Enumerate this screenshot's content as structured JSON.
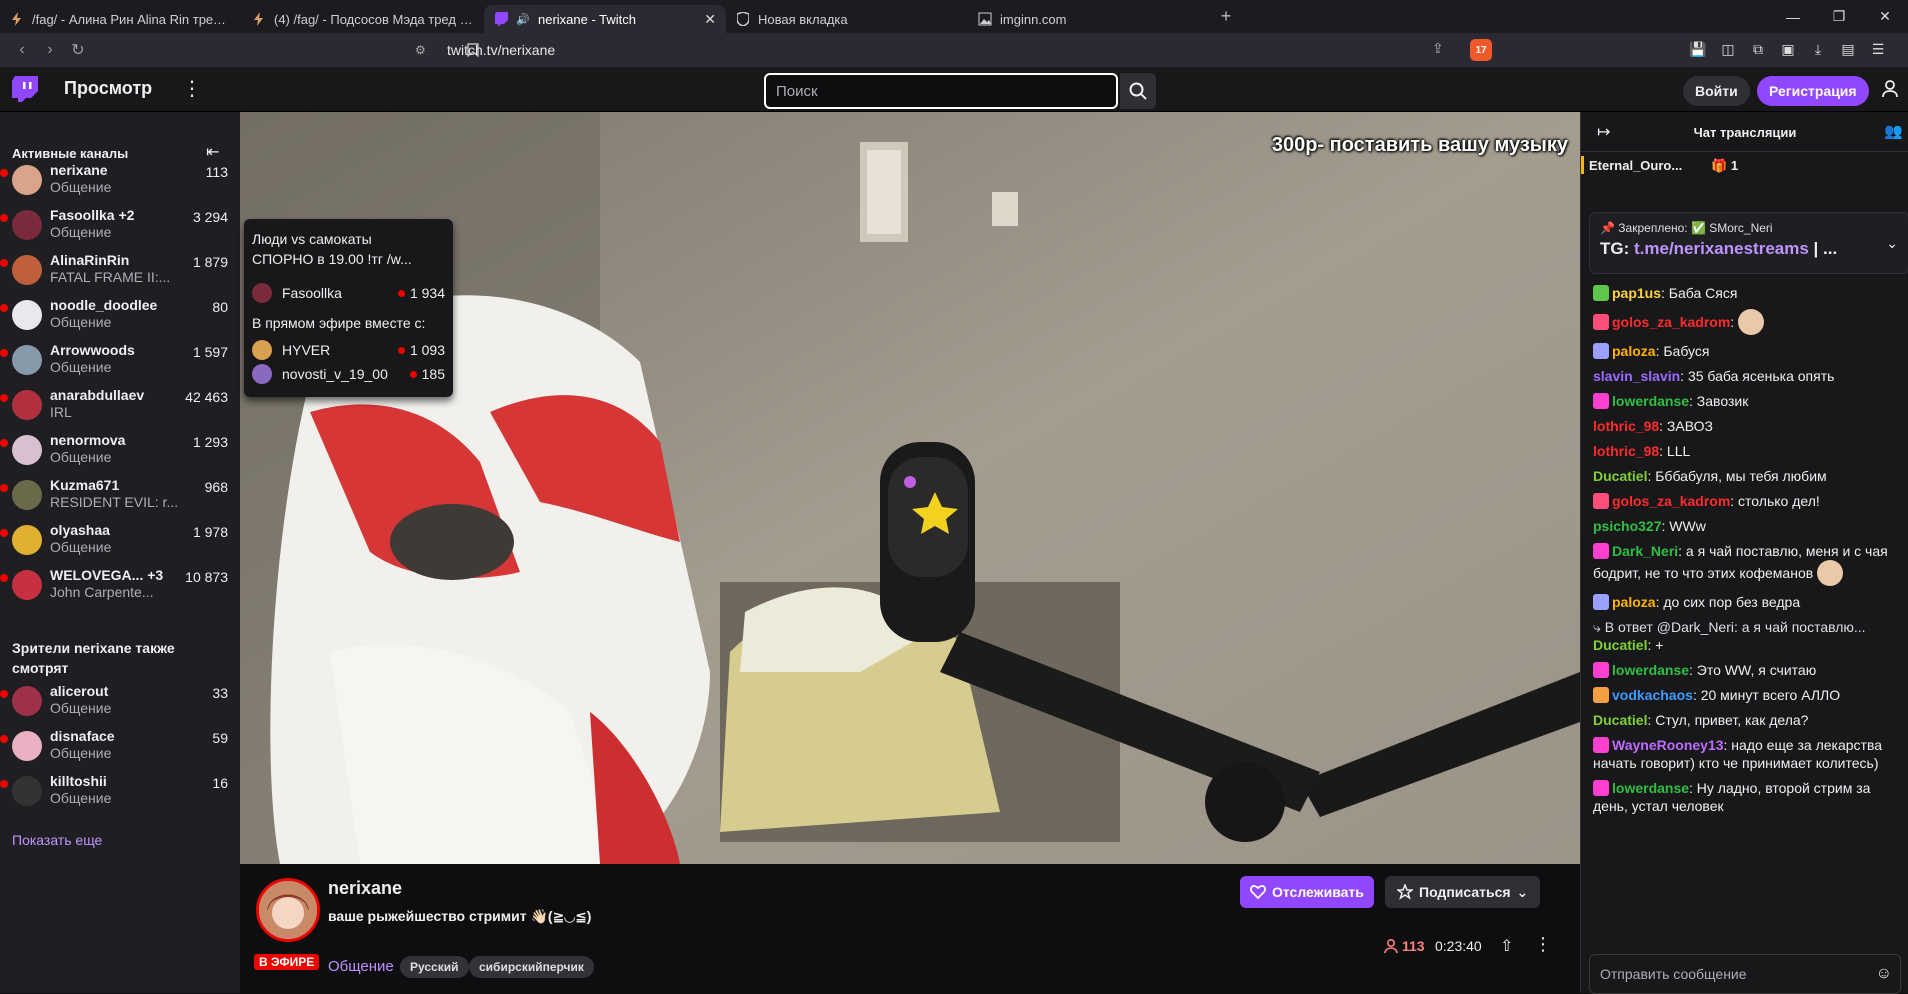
{
  "browser": {
    "tabs": [
      {
        "title": "/fag/ - Алина Рин Alina Rin тред #10",
        "active": false
      },
      {
        "title": "(4) /fag/ - Подсосов Мэда тред №12",
        "active": false
      },
      {
        "title": "nerixane - Twitch",
        "active": true
      },
      {
        "title": "Новая вкладка",
        "active": false
      },
      {
        "title": "imginn.com",
        "active": false
      }
    ],
    "new_tab": "+",
    "url": "twitch.tv/nerixane",
    "brave_badge": "17"
  },
  "twitch_nav": {
    "browse": "Просмотр",
    "search_placeholder": "Поиск",
    "login": "Войти",
    "signup": "Регистрация"
  },
  "sidebar": {
    "active_header": "Активные каналы",
    "channels": [
      {
        "name": "nerixane",
        "category": "Общение",
        "viewers": "113",
        "color": "#d9a58a"
      },
      {
        "name": "Fasoollka +2",
        "category": "Общение",
        "viewers": "3 294",
        "color": "#7a2a3a"
      },
      {
        "name": "AlinaRinRin",
        "category": "FATAL FRAME II:...",
        "viewers": "1 879",
        "color": "#c0603a"
      },
      {
        "name": "noodle_doodlee",
        "category": "Общение",
        "viewers": "80",
        "color": "#e8e8ee"
      },
      {
        "name": "Arrowwoods",
        "category": "Общение",
        "viewers": "1 597",
        "color": "#8899aa"
      },
      {
        "name": "anarabdullaev",
        "category": "IRL",
        "viewers": "42 463",
        "color": "#b03040"
      },
      {
        "name": "nenormova",
        "category": "Общение",
        "viewers": "1 293",
        "color": "#d8c0d0"
      },
      {
        "name": "Kuzma671",
        "category": "RESIDENT EVIL: r...",
        "viewers": "968",
        "color": "#6a6a4a"
      },
      {
        "name": "olyashaa",
        "category": "Общение",
        "viewers": "1 978",
        "color": "#e0b030"
      },
      {
        "name": "WELOVEGA...  +3",
        "category": "John Carpente...",
        "viewers": "10 873",
        "color": "#c83040"
      }
    ],
    "also_header": "Зрители nerixane также смотрят",
    "also": [
      {
        "name": "alicerout",
        "category": "Общение",
        "viewers": "33",
        "color": "#a0304a"
      },
      {
        "name": "disnaface",
        "category": "Общение",
        "viewers": "59",
        "color": "#e8b0c0"
      },
      {
        "name": "killtoshii",
        "category": "Общение",
        "viewers": "16",
        "color": "#333333"
      }
    ],
    "show_more": "Показать еще"
  },
  "video": {
    "overlay_text": "300р- поставить вашу музыку"
  },
  "tooltip": {
    "title_line1": "Люди vs самокаты",
    "title_line2": "СПОРНО в 19.00 !тг /w...",
    "host": {
      "name": "Fasoollka",
      "viewers": "1 934"
    },
    "with_label": "В прямом эфире вместе с:",
    "guests": [
      {
        "name": "HYVER",
        "viewers": "1 093"
      },
      {
        "name": "novosti_v_19_00",
        "viewers": "185"
      }
    ]
  },
  "stream": {
    "name": "nerixane",
    "title": "ваше рыжейшество стримит 👋🏻(≧◡≦)",
    "live_badge": "В ЭФИРЕ",
    "category": "Общение",
    "tags": [
      "Русский",
      "сибирскийперчик"
    ],
    "follow": "Отслеживать",
    "subscribe": "Подписаться",
    "viewers": "113",
    "uptime": "0:23:40"
  },
  "chat": {
    "title": "Чат трансляции",
    "gift_user": "Eternal_Ouro...",
    "gift_count": "1",
    "pinned_head": "Закреплено: ✅ SMorc_Neri",
    "pinned_prefix": "TG: ",
    "pinned_link": "t.me/nerixanestreams",
    "pinned_suffix": " | ...",
    "messages": [
      {
        "user": "pap1us",
        "color": "#ffd23f",
        "text": ": Баба Сяся",
        "badge": "#5ec64a"
      },
      {
        "user": "golos_za_kadrom",
        "color": "#ff2b2b",
        "text": ":",
        "badge": "#ff4f78",
        "emote": true
      },
      {
        "user": "paloza",
        "color": "#ffb300",
        "text": ": Бабуся",
        "badge": "#9aa0ff"
      },
      {
        "user": "slavin_slavin",
        "color": "#9b6bff",
        "text": ": 35 баба ясенька опять"
      },
      {
        "user": "lowerdanse",
        "color": "#2fbf41",
        "text": ": Завозик",
        "badge": "#ff3fd0"
      },
      {
        "user": "lothric_98",
        "color": "#ff2b2b",
        "text": ": ЗАВОЗ"
      },
      {
        "user": "lothric_98",
        "color": "#ff2b2b",
        "text": ": LLL"
      },
      {
        "user": "Ducatiel",
        "color": "#7fd039",
        "text": ": Бббабуля, мы тебя любим"
      },
      {
        "user": "golos_za_kadrom",
        "color": "#ff2b2b",
        "text": ": столько дел!",
        "badge": "#ff4f78"
      },
      {
        "user": "psicho327",
        "color": "#2fbf41",
        "text": ": WWw"
      },
      {
        "user": "Dark_Neri",
        "color": "#2fbf41",
        "text": ": а я чай поставлю, меня и с чая бодрит, не то что этих кофеманов",
        "badge": "#ff3fd0",
        "emote": true
      },
      {
        "user": "paloza",
        "color": "#ffb300",
        "text": ": до сих пор без ведра",
        "badge": "#9aa0ff"
      },
      {
        "reply": "В ответ @Dark_Neri: а я чай поставлю...",
        "user": "Ducatiel",
        "color": "#7fd039",
        "text": ": +"
      },
      {
        "user": "lowerdanse",
        "color": "#2fbf41",
        "text": ": Это WW, я считаю",
        "badge": "#ff3fd0"
      },
      {
        "user": "vodkachaos",
        "color": "#3d9bff",
        "text": ": 20 минут всего АЛЛО",
        "badge": "#f0a040"
      },
      {
        "user": "Ducatiel",
        "color": "#7fd039",
        "text": ": Стул, привет, как дела?"
      },
      {
        "user": "WayneRooney13",
        "color": "#bf6bff",
        "text": ": надо еще за лекарства начать говорит) кто че принимает колитесь)",
        "badge": "#ff3fd0"
      },
      {
        "user": "lowerdanse",
        "color": "#2fbf41",
        "text": ": Ну ладно, второй стрим за день, устал человек",
        "badge": "#ff3fd0"
      }
    ],
    "input_placeholder": "Отправить сообщение"
  },
  "colors": {
    "accent": "#9147ff",
    "live": "#eb0400",
    "link": "#bf94ff"
  }
}
